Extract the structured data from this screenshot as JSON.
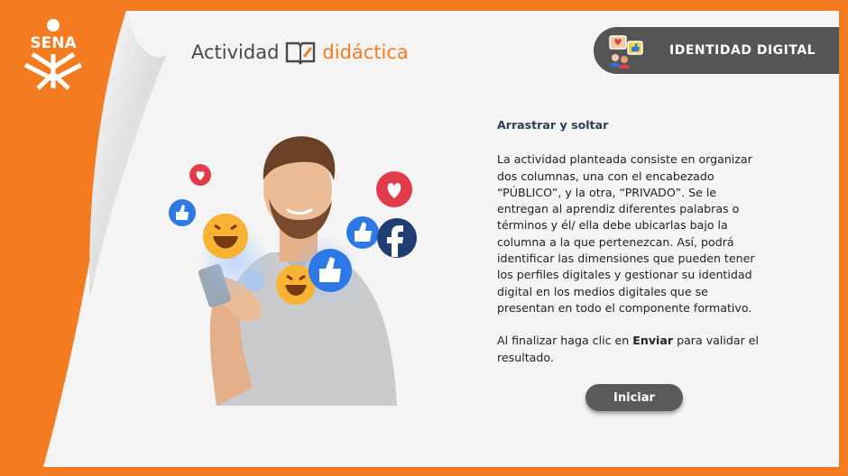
{
  "brand": {
    "logo_text": "SENA"
  },
  "header": {
    "title_part1": "Actividad",
    "title_part2": "didáctica",
    "badge_label": "IDENTIDAD DIGITAL"
  },
  "content": {
    "heading": "Arrastrar y soltar",
    "paragraph1": "La actividad planteada consiste en organizar dos columnas, una con el encabezado “PÚBLICO”, y la otra, “PRIVADO”. Se le entregan al aprendiz diferentes palabras o términos y él/ ella debe ubicarlas bajo la columna a la que pertenezcan. Así, podrá identificar las dimensiones que pueden tener los perfiles digitales y gestionar su identidad digital en los medios digitales que se presentan en todo el componente formativo.",
    "paragraph2_before": "Al finalizar haga clic en ",
    "paragraph2_bold": "Enviar",
    "paragraph2_after": " para validar el resultado."
  },
  "actions": {
    "start_label": "Iniciar"
  },
  "colors": {
    "accent": "#f47b20",
    "badge": "#555555",
    "button": "#5a5a5a",
    "heading": "#2b3f59"
  }
}
